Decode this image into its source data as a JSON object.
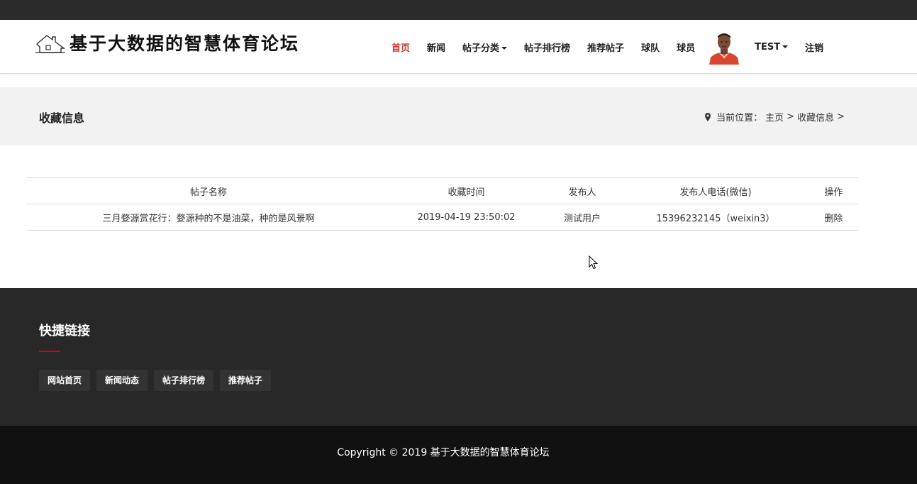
{
  "site": {
    "title": "基于大数据的智慧体育论坛"
  },
  "nav": {
    "items": [
      {
        "label": "首页",
        "active": true
      },
      {
        "label": "新闻"
      },
      {
        "label": "帖子分类",
        "dropdown": true
      },
      {
        "label": "帖子排行榜"
      },
      {
        "label": "推荐帖子"
      },
      {
        "label": "球队"
      },
      {
        "label": "球员"
      }
    ],
    "user": "TEST",
    "logout": "注销"
  },
  "page": {
    "title": "收藏信息",
    "breadcrumb_prefix": "当前位置：",
    "breadcrumb_home": "主页",
    "breadcrumb_sep1": ">",
    "breadcrumb_current": "收藏信息",
    "breadcrumb_sep2": ">"
  },
  "table": {
    "headers": [
      "帖子名称",
      "收藏时间",
      "发布人",
      "发布人电话(微信)",
      "操作"
    ],
    "rows": [
      {
        "name": "三月婺源赏花行：婺源种的不是油菜，种的是风景啊",
        "time": "2019-04-19 23:50:02",
        "publisher": "测试用户",
        "phone": "15396232145（weixin3）",
        "action": "删除"
      }
    ]
  },
  "footer": {
    "title": "快捷链接",
    "links": [
      "网站首页",
      "新闻动态",
      "帖子排行榜",
      "推荐帖子"
    ],
    "copyright": "Copyright © 2019 基于大数据的智慧体育论坛"
  },
  "colors": {
    "accent": "#c0392b",
    "footer_bg": "#282828",
    "copyright_bg": "#111111"
  }
}
